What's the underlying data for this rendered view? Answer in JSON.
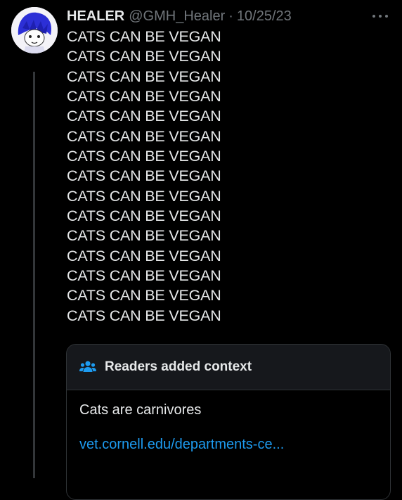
{
  "post": {
    "author": {
      "display_name": "HEALER",
      "handle": "@GMH_Healer",
      "avatar_icon": "avatar-icon"
    },
    "separator": "·",
    "date": "10/25/23",
    "more_icon": "more-dots-icon",
    "lines": [
      "CATS CAN BE VEGAN",
      "CATS CAN BE VEGAN",
      "CATS CAN BE VEGAN",
      "CATS CAN BE VEGAN",
      "CATS CAN BE VEGAN",
      "CATS CAN BE VEGAN",
      "CATS CAN BE VEGAN",
      "CATS CAN BE VEGAN",
      "CATS CAN BE VEGAN",
      "CATS CAN BE VEGAN",
      "CATS CAN BE VEGAN",
      "CATS CAN BE VEGAN",
      "CATS CAN BE VEGAN",
      "CATS CAN BE VEGAN",
      "CATS CAN BE VEGAN"
    ]
  },
  "community_note": {
    "icon": "people-icon",
    "title": "Readers added context",
    "note": "Cats are carnivores",
    "link": "vet.cornell.edu/departments-ce..."
  },
  "colors": {
    "background": "#000000",
    "text": "#e7e9ea",
    "muted": "#71767b",
    "link": "#1d9bf0",
    "icon_accent": "#1d9bf0",
    "border": "#2f3336"
  }
}
